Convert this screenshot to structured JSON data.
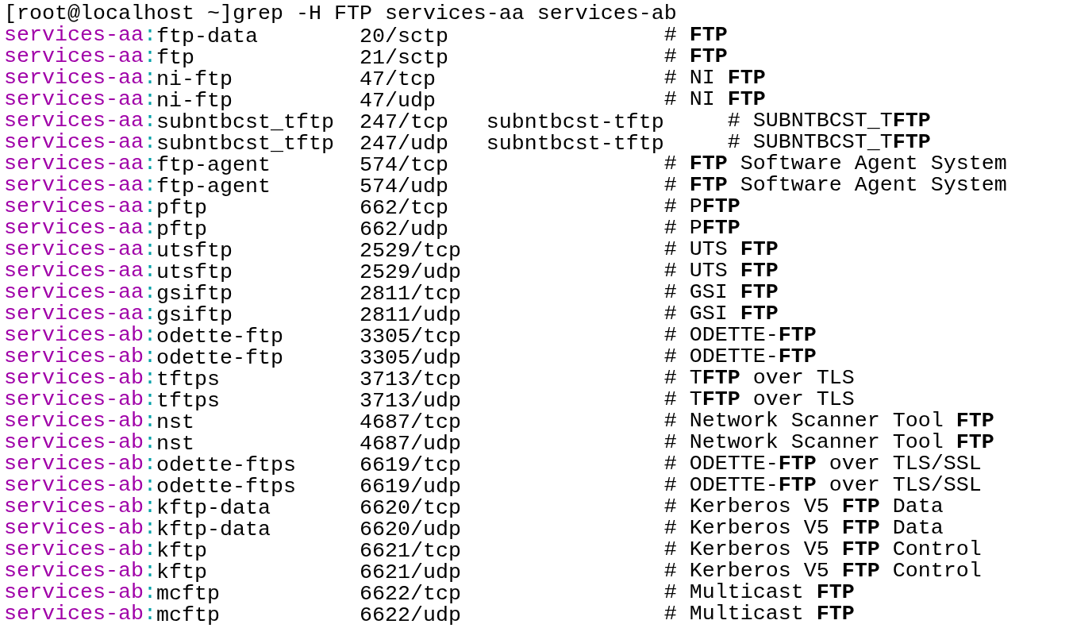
{
  "terminal": {
    "command_line": "[root@localhost ~]grep -H FTP services-aa services-ab",
    "rows": [
      {
        "file": "services-aa",
        "separator": ":",
        "service": "ftp-data",
        "port": "20/sctp",
        "comment": "# **FTP**"
      },
      {
        "file": "services-aa",
        "separator": ":",
        "service": "ftp",
        "port": "21/sctp",
        "comment": "# **FTP**"
      },
      {
        "file": "services-aa",
        "separator": ":",
        "service": "ni-ftp",
        "port": "47/tcp",
        "comment": "# NI **FTP**"
      },
      {
        "file": "services-aa",
        "separator": ":",
        "service": "ni-ftp",
        "port": "47/udp",
        "comment": "# NI **FTP**"
      },
      {
        "file": "services-aa",
        "separator": ":",
        "service": "subntbcst_tftp",
        "port": "247/tcp",
        "alias": "subntbcst-tftp",
        "comment": "# SUBNTBCST_T**FTP**"
      },
      {
        "file": "services-aa",
        "separator": ":",
        "service": "subntbcst_tftp",
        "port": "247/udp",
        "alias": "subntbcst-tftp",
        "comment": "# SUBNTBCST_T**FTP**"
      },
      {
        "file": "services-aa",
        "separator": ":",
        "service": "ftp-agent",
        "port": "574/tcp",
        "comment": "# **FTP** Software Agent System"
      },
      {
        "file": "services-aa",
        "separator": ":",
        "service": "ftp-agent",
        "port": "574/udp",
        "comment": "# **FTP** Software Agent System"
      },
      {
        "file": "services-aa",
        "separator": ":",
        "service": "pftp",
        "port": "662/tcp",
        "comment": "# P**FTP**"
      },
      {
        "file": "services-aa",
        "separator": ":",
        "service": "pftp",
        "port": "662/udp",
        "comment": "# P**FTP**"
      },
      {
        "file": "services-aa",
        "separator": ":",
        "service": "utsftp",
        "port": "2529/tcp",
        "comment": "# UTS **FTP**"
      },
      {
        "file": "services-aa",
        "separator": ":",
        "service": "utsftp",
        "port": "2529/udp",
        "comment": "# UTS **FTP**"
      },
      {
        "file": "services-aa",
        "separator": ":",
        "service": "gsiftp",
        "port": "2811/tcp",
        "comment": "# GSI **FTP**"
      },
      {
        "file": "services-aa",
        "separator": ":",
        "service": "gsiftp",
        "port": "2811/udp",
        "comment": "# GSI **FTP**"
      },
      {
        "file": "services-ab",
        "separator": ":",
        "service": "odette-ftp",
        "port": "3305/tcp",
        "comment": "# ODETTE-**FTP**"
      },
      {
        "file": "services-ab",
        "separator": ":",
        "service": "odette-ftp",
        "port": "3305/udp",
        "comment": "# ODETTE-**FTP**"
      },
      {
        "file": "services-ab",
        "separator": ":",
        "service": "tftps",
        "port": "3713/tcp",
        "comment": "# T**FTP** over TLS"
      },
      {
        "file": "services-ab",
        "separator": ":",
        "service": "tftps",
        "port": "3713/udp",
        "comment": "# T**FTP** over TLS"
      },
      {
        "file": "services-ab",
        "separator": ":",
        "service": "nst",
        "port": "4687/tcp",
        "comment": "# Network Scanner Tool **FTP**"
      },
      {
        "file": "services-ab",
        "separator": ":",
        "service": "nst",
        "port": "4687/udp",
        "comment": "# Network Scanner Tool **FTP**"
      },
      {
        "file": "services-ab",
        "separator": ":",
        "service": "odette-ftps",
        "port": "6619/tcp",
        "comment": "# ODETTE-**FTP** over TLS/SSL"
      },
      {
        "file": "services-ab",
        "separator": ":",
        "service": "odette-ftps",
        "port": "6619/udp",
        "comment": "# ODETTE-**FTP** over TLS/SSL"
      },
      {
        "file": "services-ab",
        "separator": ":",
        "service": "kftp-data",
        "port": "6620/tcp",
        "comment": "# Kerberos V5 **FTP** Data"
      },
      {
        "file": "services-ab",
        "separator": ":",
        "service": "kftp-data",
        "port": "6620/udp",
        "comment": "# Kerberos V5 **FTP** Data"
      },
      {
        "file": "services-ab",
        "separator": ":",
        "service": "kftp",
        "port": "6621/tcp",
        "comment": "# Kerberos V5 **FTP** Control"
      },
      {
        "file": "services-ab",
        "separator": ":",
        "service": "kftp",
        "port": "6621/udp",
        "comment": "# Kerberos V5 **FTP** Control"
      },
      {
        "file": "services-ab",
        "separator": ":",
        "service": "mcftp",
        "port": "6622/tcp",
        "comment": "# Multicast **FTP**"
      },
      {
        "file": "services-ab",
        "separator": ":",
        "service": "mcftp",
        "port": "6622/udp",
        "comment": "# Multicast **FTP**"
      }
    ]
  }
}
